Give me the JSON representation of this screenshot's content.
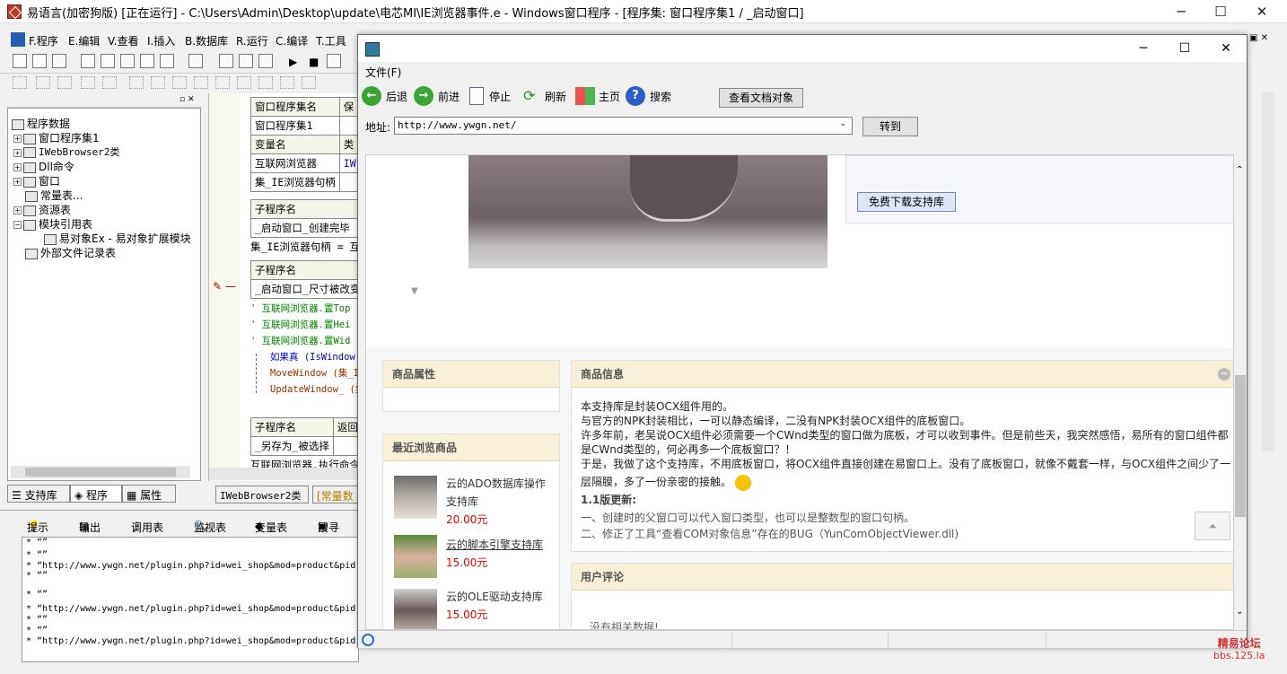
{
  "main_window": {
    "title": "易语言(加密狗版) [正在运行] - C:\\Users\\Admin\\Desktop\\update\\电芯MI\\IE浏览器事件.e - Windows窗口程序 - [程序集: 窗口程序集1 / _启动窗口]"
  },
  "menu": [
    "F.程序",
    "E.编辑",
    "V.查看",
    "I.插入",
    "B.数据库",
    "R.运行",
    "C.编译",
    "T.工具"
  ],
  "tree": {
    "root": "程序数据",
    "items": [
      "窗口程序集1",
      "IWebBrowser2类",
      "Dll命令",
      "窗口",
      "常量表...",
      "资源表",
      "模块引用表",
      "易对象Ex - 易对象扩展模块",
      "外部文件记录表"
    ]
  },
  "left_tabs": [
    "支持库",
    "程序",
    "属性"
  ],
  "code": {
    "t1_h": [
      "窗口程序集名",
      "保"
    ],
    "t1_r": [
      "窗口程序集1",
      ""
    ],
    "t2_h": [
      "变量名",
      "类"
    ],
    "t2_r1": [
      "互联网浏览器",
      "IW"
    ],
    "t2_r2": [
      "集_IE浏览器句柄",
      ""
    ],
    "t3_h": "子程序名",
    "t3_r": "_启动窗口_创建完毕",
    "line1": "集_IE浏览器句柄 = 互",
    "t4_h": "子程序名",
    "t4_r": "_启动窗口_尺寸被改变",
    "c1": "' 互联网浏览器.置Top",
    "c2": "' 互联网浏览器.置Hei",
    "c3": "' 互联网浏览器.置Wid",
    "c4": "如果真 (IsWindow",
    "c5": "MoveWindow (集_IE",
    "c6": "UpdateWindow_ (集",
    "t5_h": [
      "子程序名",
      "返回"
    ],
    "t5_r": "_另存为_被选择",
    "line2": "互联网浏览器.执行命令"
  },
  "code_tabs": [
    "IWebBrowser2类",
    "[常量数"
  ],
  "bottom_tabs": [
    "提示",
    "输出",
    "调用表",
    "监视表",
    "变量表",
    "搜寻"
  ],
  "output_lines": [
    "* “”",
    "* “”",
    "* “http://www.ywgn.net/plugin.php?id=wei_shop&mod=product&pid",
    "* “”",
    "* “”",
    "* “http://www.ywgn.net/plugin.php?id=wei_shop&mod=product&pid",
    "* “”",
    "* “”",
    "* “http://www.ywgn.net/plugin.php?id=wei_shop&mod=product&pid"
  ],
  "browser": {
    "menu_file": "文件(F)",
    "back": "后退",
    "forward": "前进",
    "stop": "停止",
    "refresh": "刷新",
    "home": "主页",
    "search": "搜索",
    "view_doc": "查看文档对象",
    "address_label": "地址:",
    "address": "http://www.ywgn.net/",
    "go": "转到",
    "page": {
      "download_btn": "免费下载支持库",
      "attr_header": "商品属性",
      "info_header": "商品信息",
      "info_lines": [
        "本支持库是封装OCX组件用的。",
        "与官方的NPK封装相比，一可以静态编译，二没有NPK封装OCX组件的底板窗口。",
        "许多年前，老吴说OCX组件必须需要一个CWnd类型的窗口做为底板，才可以收到事件。但是前些天，我突然感悟，易所有的窗口组件都",
        "是CWnd类型的，何必再多一个底板窗口？！",
        "于是，我做了这个支持库，不用底板窗口，将OCX组件直接创建在易窗口上。没有了底板窗口，就像不戴套一样，与OCX组件之间少了一",
        "层隔膜，多了一份亲密的接触。"
      ],
      "update_title": "1.1版更新:",
      "update_lines": [
        "一、创建时的父窗口可以代入窗口类型，也可以是整数型的窗口句柄。",
        "二、修正了工具“查看COM对象信息”存在的BUG（YunComObjectViewer.dll)"
      ],
      "recent_header": "最近浏览商品",
      "products": [
        {
          "name1": "云的ADO数据库操作",
          "name2": "支持库",
          "price": "20.00元"
        },
        {
          "name1": "云的脚本引擎支持库",
          "name2": "",
          "price": "15.00元"
        },
        {
          "name1": "云的OLE驱动支持库",
          "name2": "",
          "price": "15.00元"
        }
      ],
      "review_header": "用户评论",
      "review_empty": "没有相关数据!"
    }
  },
  "watermark": {
    "line1": "精易论坛",
    "line2": "bbs.125.la"
  }
}
